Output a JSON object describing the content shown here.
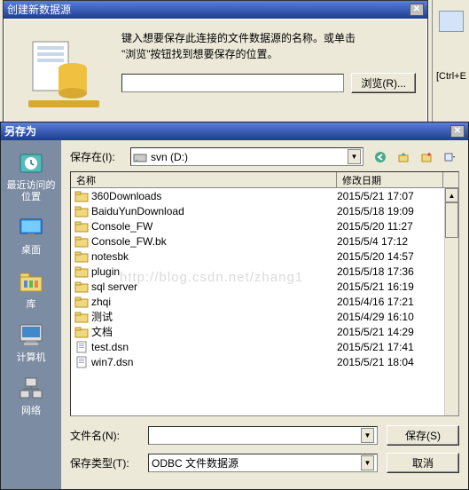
{
  "dlg1": {
    "title": "创建新数据源",
    "instruction_line1": "键入想要保存此连接的文件数据源的名称。或单击",
    "instruction_line2": "\"浏览\"按钮找到想要保存的位置。",
    "input_value": "",
    "browse_label": "浏览(R)..."
  },
  "right_hint": "[Ctrl+E",
  "dlg2": {
    "title": "另存为",
    "lookin_label": "保存在(I):",
    "lookin_value": "svn (D:)",
    "places": [
      {
        "key": "recent",
        "label": "最近访问的位置"
      },
      {
        "key": "desktop",
        "label": "桌面"
      },
      {
        "key": "libraries",
        "label": "库"
      },
      {
        "key": "computer",
        "label": "计算机"
      },
      {
        "key": "network",
        "label": "网络"
      }
    ],
    "cols": {
      "name": "名称",
      "date": "修改日期"
    },
    "rows": [
      {
        "type": "folder",
        "name": "360Downloads",
        "date": "2015/5/21 17:07"
      },
      {
        "type": "folder",
        "name": "BaiduYunDownload",
        "date": "2015/5/18 19:09"
      },
      {
        "type": "folder",
        "name": "Console_FW",
        "date": "2015/5/20 11:27"
      },
      {
        "type": "folder",
        "name": "Console_FW.bk",
        "date": "2015/5/4 17:12"
      },
      {
        "type": "folder",
        "name": "notesbk",
        "date": "2015/5/20 14:57"
      },
      {
        "type": "folder",
        "name": "plugin",
        "date": "2015/5/18 17:36"
      },
      {
        "type": "folder",
        "name": "sql server",
        "date": "2015/5/21 16:19"
      },
      {
        "type": "folder",
        "name": "zhqi",
        "date": "2015/4/16 17:21"
      },
      {
        "type": "folder",
        "name": "测试",
        "date": "2015/4/29 16:10"
      },
      {
        "type": "folder",
        "name": "文档",
        "date": "2015/5/21 14:29"
      },
      {
        "type": "dsn",
        "name": "test.dsn",
        "date": "2015/5/21 17:41"
      },
      {
        "type": "dsn",
        "name": "win7.dsn",
        "date": "2015/5/21 18:04"
      }
    ],
    "filename_label": "文件名(N):",
    "filename_value": "",
    "filetype_label": "保存类型(T):",
    "filetype_value": "ODBC 文件数据源",
    "save_label": "保存(S)",
    "cancel_label": "取消"
  },
  "watermark": "http://blog.csdn.net/zhang1"
}
